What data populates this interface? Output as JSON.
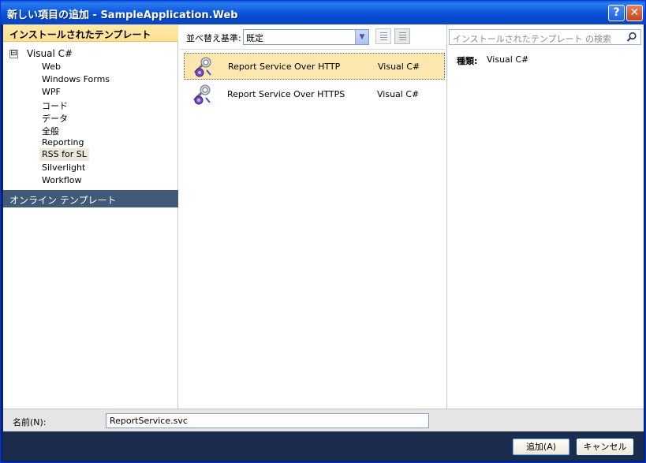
{
  "window": {
    "title": "新しい項目の追加 - SampleApplication.Web",
    "help_label": "?",
    "close_label": "✕"
  },
  "left": {
    "header": "インストールされたテンプレート",
    "tree_toggle": "⊟",
    "root_label": "Visual C#",
    "items": [
      {
        "label": "Web"
      },
      {
        "label": "Windows Forms"
      },
      {
        "label": "WPF"
      },
      {
        "label": "コード"
      },
      {
        "label": "データ"
      },
      {
        "label": "全般"
      },
      {
        "label": "Reporting"
      },
      {
        "label": "RSS for SL",
        "selected": true
      },
      {
        "label": "Silverlight"
      },
      {
        "label": "Workflow"
      }
    ],
    "online_label": "オンライン テンプレート"
  },
  "middle": {
    "sort_label": "並べ替え基準:",
    "sort_value": "既定",
    "templates": [
      {
        "name": "Report Service Over HTTP",
        "language": "Visual C#",
        "selected": true
      },
      {
        "name": "Report Service Over HTTPS",
        "language": "Visual C#",
        "selected": false
      }
    ]
  },
  "right": {
    "search_placeholder": "インストールされたテンプレート の検索",
    "type_label": "種類:",
    "type_value": "Visual C#"
  },
  "bottom": {
    "name_label": "名前(N):",
    "name_value": "ReportService.svc",
    "add_label": "追加(A)",
    "cancel_label": "キャンセル"
  }
}
